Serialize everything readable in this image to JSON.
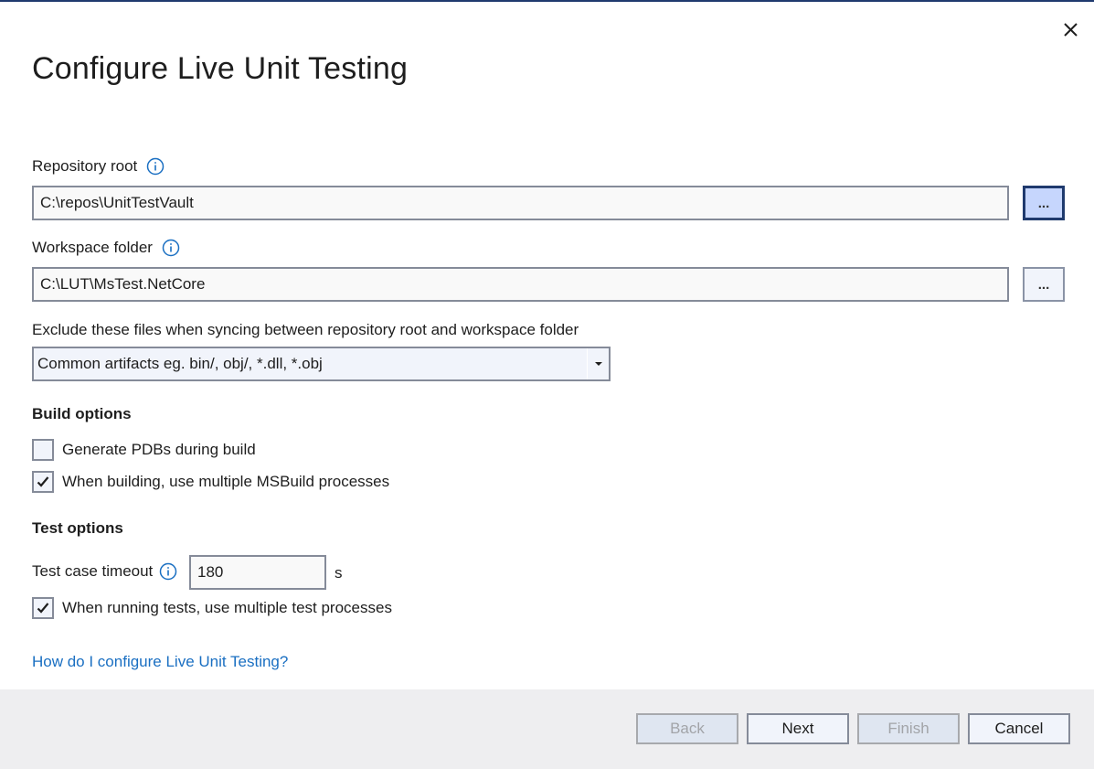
{
  "dialog": {
    "title": "Configure Live Unit Testing",
    "close_icon": "close-icon"
  },
  "repository_root": {
    "label": "Repository root",
    "info_icon": "info-icon",
    "value": "C:\\repos\\UnitTestVault",
    "browse_label": "..."
  },
  "workspace_folder": {
    "label": "Workspace folder",
    "info_icon": "info-icon",
    "value": "C:\\LUT\\MsTest.NetCore",
    "browse_label": "..."
  },
  "exclude": {
    "label": "Exclude these files when syncing between repository root and workspace folder",
    "selected": "Common artifacts eg. bin/, obj/, *.dll, *.obj"
  },
  "build_options": {
    "heading": "Build options",
    "options": [
      {
        "label": "Generate PDBs during build",
        "checked": false
      },
      {
        "label": "When building, use multiple MSBuild processes",
        "checked": true
      }
    ]
  },
  "test_options": {
    "heading": "Test options",
    "timeout_label": "Test case timeout",
    "timeout_value": "180",
    "timeout_unit": "s",
    "options": [
      {
        "label": "When running tests, use multiple test processes",
        "checked": true
      }
    ]
  },
  "help_link": "How do I configure Live Unit Testing?",
  "footer": {
    "buttons": [
      {
        "label": "Back",
        "enabled": false
      },
      {
        "label": "Next",
        "enabled": true
      },
      {
        "label": "Finish",
        "enabled": false
      },
      {
        "label": "Cancel",
        "enabled": true
      }
    ]
  },
  "colors": {
    "accent": "#1f3a6e",
    "link": "#1a6fc2",
    "footer_bg": "#eeeef0",
    "active_browse_bg": "#c6d6fd"
  }
}
